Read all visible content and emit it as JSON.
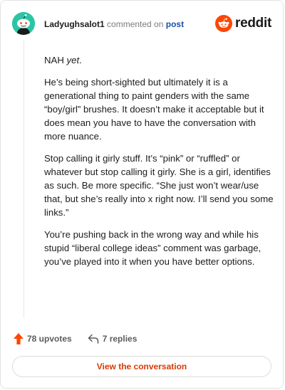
{
  "comment": {
    "username": "Ladyughsalot1",
    "commented_on": "commented on",
    "post_label": "post",
    "first_para": {
      "lead": "NAH",
      "emph": "yet",
      "tail": "."
    },
    "paragraphs": [
      "He’s being short-sighted but ultimately it is a generational thing to paint genders with the same “boy/girl” brushes. It doesn’t make it acceptable but it does mean you have to have the conversation with more nuance.",
      "Stop calling it girly stuff. It’s “pink” or “ruffled” or whatever but stop calling it girly. She is a girl, identifies as such. Be more specific. “She just won’t wear/use that, but she’s really into x right now. I’ll send you some links.”",
      "You’re pushing back in the wrong way and while his stupid “liberal college ideas” comment was garbage, you’ve played into it when you have better options."
    ]
  },
  "brand": {
    "wordmark": "reddit",
    "accent": "#ff4500"
  },
  "footer": {
    "upvotes": "78 upvotes",
    "replies": "7 replies",
    "upvote_icon": "upvote-arrow-icon",
    "reply_icon": "reply-arrow-icon"
  },
  "cta": {
    "label": "View the conversation",
    "color": "#d93a00"
  },
  "colors": {
    "avatar_bg": "#2bc5a6",
    "link": "#1a4fa7",
    "upvote": "#ff4500"
  }
}
